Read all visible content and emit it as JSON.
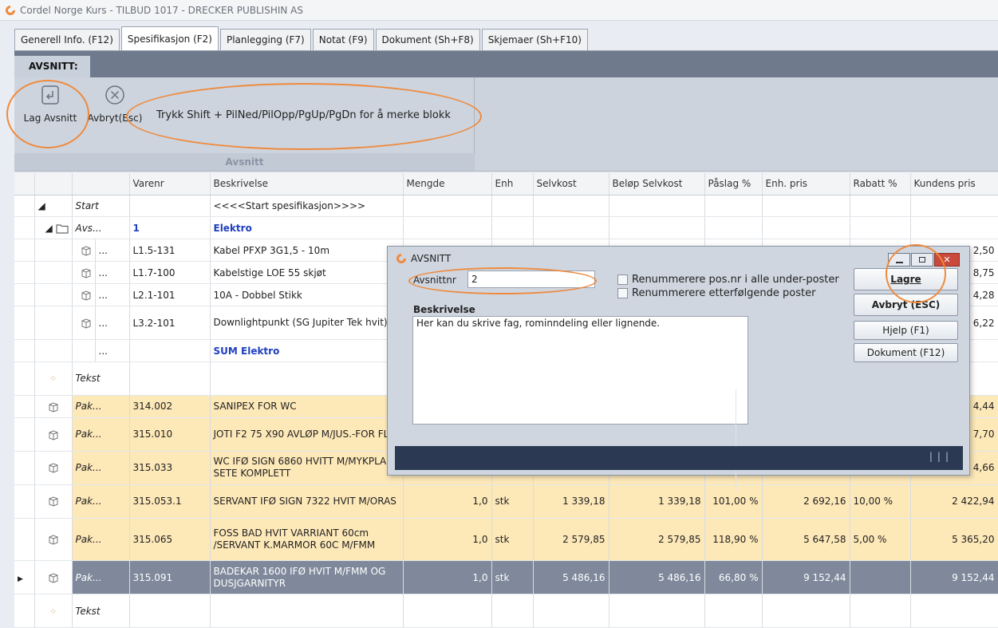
{
  "window": {
    "title": "Cordel Norge Kurs - TILBUD 1017 - DRECKER PUBLISHIN AS"
  },
  "tabs": [
    {
      "label": "Generell Info. (F12)",
      "active": false
    },
    {
      "label": "Spesifikasjon (F2)",
      "active": true
    },
    {
      "label": "Planlegging (F7)",
      "active": false
    },
    {
      "label": "Notat (F9)",
      "active": false
    },
    {
      "label": "Dokument (Sh+F8)",
      "active": false
    },
    {
      "label": "Skjemaer (Sh+F10)",
      "active": false
    }
  ],
  "ribbon": {
    "tab": "AVSNITT:",
    "group_label": "Avsnitt",
    "lag_avsnitt": "Lag Avsnitt",
    "avbryt": "Avbryt(Esc)",
    "hint": "Trykk Shift + PilNed/PilOpp/PgUp/PgDn for å merke blokk"
  },
  "grid": {
    "columns": [
      "Varenr",
      "Beskrivelse",
      "Mengde",
      "Enh",
      "Selvkost",
      "Beløp Selvkost",
      "Påslag %",
      "Enh. pris",
      "Rabatt %",
      "Kundens pris"
    ],
    "rows": {
      "start": {
        "type": "Start",
        "beskrivelse": "<<<<Start spesifikasjon>>>>"
      },
      "section": {
        "type": "Avs...",
        "varenr": "1",
        "beskrivelse": "Elektro"
      },
      "l1": {
        "type": "...",
        "varenr": "L1.5-131",
        "beskrivelse": "Kabel PFXP 3G1,5 - 10m",
        "kundens_pris_partial": "2,50"
      },
      "l2": {
        "type": "...",
        "varenr": "L1.7-100",
        "beskrivelse": "Kabelstige LOE 55 skjøt",
        "kundens_pris_partial": "8,75"
      },
      "l3": {
        "type": "...",
        "varenr": "L2.1-101",
        "beskrivelse": "10A - Dobbel Stikk",
        "kundens_pris_partial": "4,28"
      },
      "l4": {
        "type": "...",
        "varenr": "L3.2-101",
        "beskrivelse": "Downlightpunkt (SG Jupiter Tek hvit)",
        "kundens_pris_partial": "6,22"
      },
      "sum": {
        "type": "...",
        "beskrivelse": "SUM Elektro"
      },
      "tekst1": {
        "type": "Tekst"
      },
      "p1": {
        "type": "Pak...",
        "varenr": "314.002",
        "beskrivelse": "SANIPEX FOR WC",
        "kundens_pris_partial": "4,44"
      },
      "p2": {
        "type": "Pak...",
        "varenr": "315.010",
        "beskrivelse": "JOTI F2 75 X90 AVLØP M/JUS.-FOR FLIS",
        "kundens_pris_partial": "7,70"
      },
      "p3": {
        "type": "Pak...",
        "varenr": "315.033",
        "beskrivelse": "WC IFØ SIGN 6860 HVITT M/MYKPLAST SETE KOMPLETT",
        "kundens_pris_partial": "4,66"
      },
      "p4": {
        "type": "Pak...",
        "varenr": "315.053.1",
        "beskrivelse": "SERVANT IFØ SIGN 7322 HVIT M/ORAS",
        "mengde": "1,0",
        "enh": "stk",
        "selvkost": "1 339,18",
        "belop_selvkost": "1 339,18",
        "paslag": "101,00 %",
        "enh_pris": "2 692,16",
        "rabatt": "10,00 %",
        "kundens_pris": "2 422,94"
      },
      "p5": {
        "type": "Pak...",
        "varenr": "315.065",
        "beskrivelse": "FOSS BAD HVIT VARRIANT 60cm /SERVANT K.MARMOR 60C M/FMM",
        "mengde": "1,0",
        "enh": "stk",
        "selvkost": "2 579,85",
        "belop_selvkost": "2 579,85",
        "paslag": "118,90 %",
        "enh_pris": "5 647,58",
        "rabatt": "5,00 %",
        "kundens_pris": "5 365,20"
      },
      "p6": {
        "type": "Pak...",
        "varenr": "315.091",
        "beskrivelse": "BADEKAR 1600 IFØ HVIT M/FMM OG DUSJGARNITYR",
        "mengde": "1,0",
        "enh": "stk",
        "selvkost": "5 486,16",
        "belop_selvkost": "5 486,16",
        "paslag": "66,80 %",
        "enh_pris": "9 152,44",
        "rabatt": "",
        "kundens_pris": "9 152,44"
      },
      "tekst2": {
        "type": "Tekst"
      }
    }
  },
  "dialog": {
    "title": "AVSNITT",
    "avsnittnr_label": "Avsnittnr",
    "avsnittnr_value": "2",
    "chk1": "Renummerere pos.nr i alle under-poster",
    "chk2": "Renummerere etterfølgende poster",
    "beskrivelse_label": "Beskrivelse",
    "beskrivelse_value": "Her kan du skrive fag, rominndeling eller lignende.",
    "lagre": "Lagre",
    "avbryt": "Avbryt (ESC)",
    "hjelp": "Hjelp (F1)",
    "dokument": "Dokument (F12)"
  },
  "colors": {
    "accent": "#ef8a3c",
    "package_row": "#fde8b8",
    "selected_row": "#7f899b",
    "ribbon_dark": "#6f7b8d"
  }
}
